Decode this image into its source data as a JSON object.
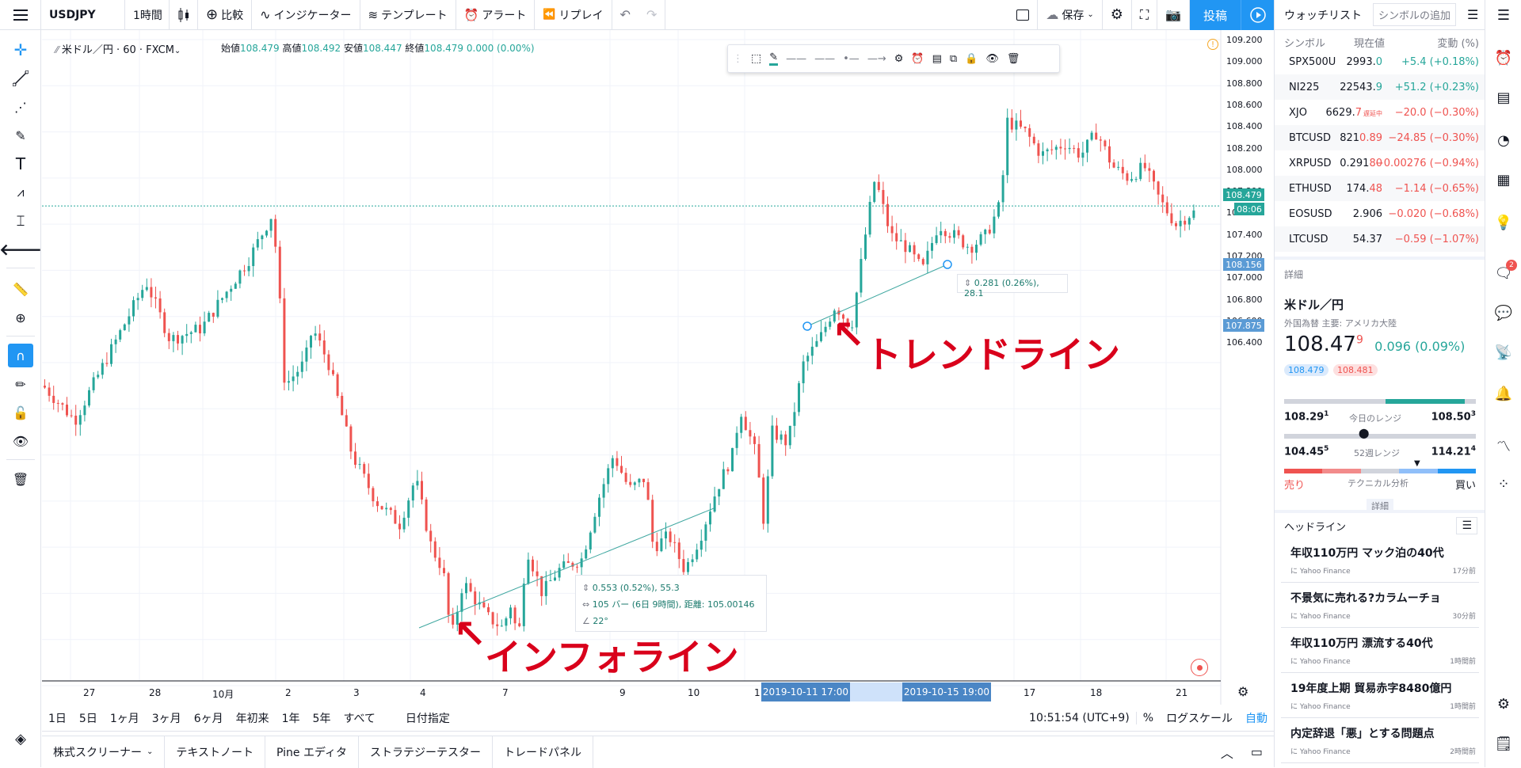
{
  "topbar": {
    "symbol": "USDJPY",
    "interval": "1時間",
    "compare": "比較",
    "indicators": "インジケーター",
    "templates": "テンプレート",
    "alert": "アラート",
    "replay": "リプレイ",
    "save": "保存",
    "post": "投稿"
  },
  "legend": {
    "title": "米ドル／円 · 60 · FXCM",
    "open_label": "始値",
    "open": "108.479",
    "high_label": "高値",
    "high": "108.492",
    "low_label": "安値",
    "low": "108.447",
    "close_label": "終値",
    "close": "108.479",
    "change": "0.000 (0.00%)"
  },
  "price_axis": {
    "labels": [
      "109.200",
      "109.000",
      "108.800",
      "108.600",
      "108.400",
      "108.200",
      "108.000",
      "107.800",
      "107.600",
      "107.400",
      "107.200",
      "107.000",
      "106.800",
      "106.600",
      "106.400"
    ],
    "current_price": "108.479",
    "countdown": "08:06",
    "line_tag_upper": "108.156",
    "line_tag_lower": "107.875"
  },
  "time_axis": {
    "labels": [
      "27",
      "28",
      "10月",
      "2",
      "3",
      "4",
      "7",
      "9",
      "10",
      "1",
      "17",
      "18",
      "21"
    ],
    "highlight_start": "2019-10-11   17:00",
    "highlight_end": "2019-10-15   19:00"
  },
  "annotations": {
    "info_line_label": "インフォライン",
    "trend_line_label": "トレンドライン",
    "info_stats": [
      "0.553 (0.52%), 55.3",
      "105 バー (6日 9時間), 距離: 105.00146",
      "22°"
    ],
    "trend_stats": "0.281 (0.26%), 28.1"
  },
  "bottombar": {
    "ranges": [
      "1日",
      "5日",
      "1ヶ月",
      "3ヶ月",
      "6ヶ月",
      "年初来",
      "1年",
      "5年",
      "すべて"
    ],
    "date_range": "日付指定",
    "clock": "10:51:54 (UTC+9)",
    "percent": "%",
    "log_scale": "ログスケール",
    "auto": "自動"
  },
  "bottom_panel": {
    "tabs": [
      "株式スクリーナー",
      "テキストノート",
      "Pine エディタ",
      "ストラテジーテスター",
      "トレードパネル"
    ]
  },
  "watchlist": {
    "title": "ウォッチリスト",
    "add_placeholder": "シンボルの追加",
    "col_symbol": "シンボル",
    "col_price": "現在値",
    "col_change": "変動 (%)",
    "rows": [
      {
        "symbol": "SPX500U",
        "price": "2993.",
        "price_hl": "0",
        "change": "+5.4 (+0.18%)",
        "dir": "pos"
      },
      {
        "symbol": "NI225",
        "price": "22543.",
        "price_hl": "9",
        "change": "+51.2 (+0.23%)",
        "dir": "pos"
      },
      {
        "symbol": "XJO",
        "price": "6629.",
        "price_hl": "7",
        "badge": "遅延中",
        "change": "−20.0 (−0.30%)",
        "dir": "neg"
      },
      {
        "symbol": "BTCUSD",
        "price": "821",
        "price_hl": "0.89",
        "change": "−24.85 (−0.30%)",
        "dir": "neg"
      },
      {
        "symbol": "XRPUSD",
        "price": "0.291",
        "price_hl": "80",
        "change": "−0.00276 (−0.94%)",
        "dir": "neg"
      },
      {
        "symbol": "ETHUSD",
        "price": "174.",
        "price_hl": "48",
        "change": "−1.14 (−0.65%)",
        "dir": "neg"
      },
      {
        "symbol": "EOSUSD",
        "price": "2.906",
        "price_hl": "",
        "change": "−0.020 (−0.68%)",
        "dir": "neg"
      },
      {
        "symbol": "LTCUSD",
        "price": "54.37",
        "price_hl": "",
        "change": "−0.59 (−1.07%)",
        "dir": "neg"
      }
    ]
  },
  "details": {
    "header": "詳細",
    "name": "米ドル／円",
    "subtitle": "外国為替 主要: アメリカ大陸",
    "price_main": "108.47",
    "price_sup": "9",
    "change": "0.096 (0.09%)",
    "bid": "108.479",
    "ask": "108.481",
    "day_low": "108.29",
    "day_low_sup": "1",
    "day_range_label": "今日のレンジ",
    "day_high": "108.50",
    "day_high_sup": "3",
    "week_low": "104.45",
    "week_low_sup": "5",
    "week_range_label": "52週レンジ",
    "week_high": "114.21",
    "week_high_sup": "4",
    "sell": "売り",
    "technical": "テクニカル分析",
    "buy": "買い",
    "more": "詳細"
  },
  "headlines": {
    "title": "ヘッドライン",
    "items": [
      {
        "title": "年収110万円 マック泊の40代",
        "source": "に Yahoo Finance",
        "time": "17分前"
      },
      {
        "title": "不景気に売れる?カラムーチョ",
        "source": "に Yahoo Finance",
        "time": "30分前"
      },
      {
        "title": "年収110万円 漂流する40代",
        "source": "に Yahoo Finance",
        "time": "1時間前"
      },
      {
        "title": "19年度上期 貿易赤字8480億円",
        "source": "に Yahoo Finance",
        "time": "1時間前"
      },
      {
        "title": "内定辞退「悪」とする問題点",
        "source": "に Yahoo Finance",
        "time": "2時間前"
      }
    ]
  },
  "notification_count": "2",
  "colors": {
    "up": "#26a69a",
    "down": "#ef5350",
    "accent": "#2196f3",
    "annotation": "#d9001b"
  }
}
